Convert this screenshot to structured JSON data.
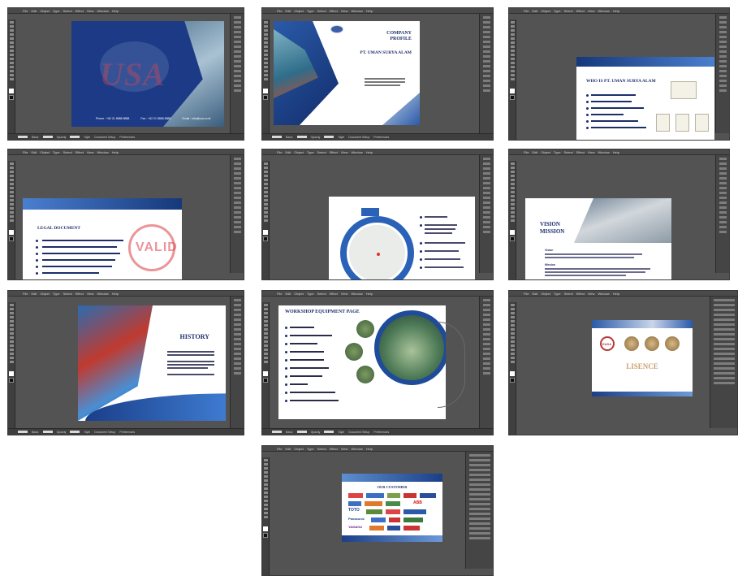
{
  "ui": {
    "menu_items": [
      "File",
      "Edit",
      "Object",
      "Type",
      "Select",
      "Effect",
      "View",
      "Window",
      "Help"
    ],
    "statusbar_labels": [
      "Basic",
      "Opacity",
      "Style",
      "Document Setup",
      "Preferences"
    ]
  },
  "slides": {
    "s1": {
      "watermark": "USA",
      "contact": [
        "Phone : +62 21 8888 8888",
        "Fax : +62 21 8888 8888",
        "Email : info@usa.co.id"
      ]
    },
    "s2": {
      "title_line1": "COMPANY",
      "title_line2": "PROFILE",
      "subtitle": "PT. UMAN SURYA ALAM"
    },
    "s3": {
      "title": "WHO IS PT. UMAN SURYA ALAM"
    },
    "s4": {
      "title": "LEGAL DOCUMENT",
      "stamp": "VALID"
    },
    "s5": {
      "map_badge": ""
    },
    "s6": {
      "title_line1": "VISION",
      "title_line2": "MISSION",
      "vision_label": "Vision",
      "mission_label": "Mission"
    },
    "s7": {
      "title": "HISTORY"
    },
    "s8": {
      "title": "WORKSHOP EQUIPMENT PAGE"
    },
    "s9": {
      "easa": "EASA",
      "title": "LISENCE"
    },
    "s10": {
      "title": "OUR CUSTOMER",
      "customers": [
        "TOTO",
        "ABB",
        "Panasonic",
        "YAMAHA"
      ]
    }
  }
}
